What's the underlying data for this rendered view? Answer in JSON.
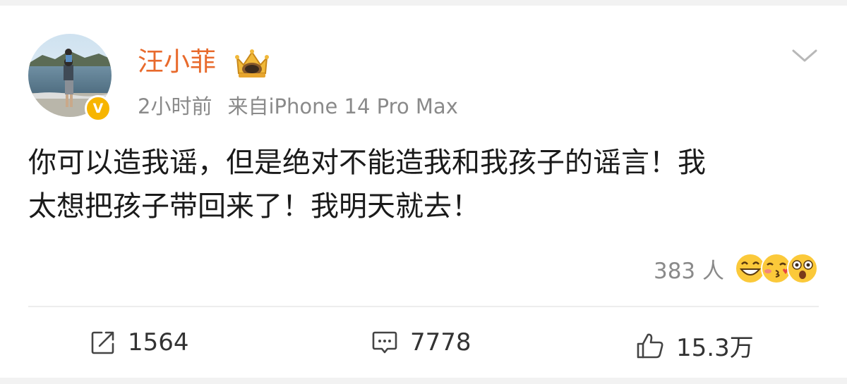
{
  "post": {
    "author": {
      "name": "汪小菲",
      "badge_icon": "crown-badge-icon",
      "verified_icon": "verified-v-icon",
      "verified_mark": "V",
      "name_color": "#e86a2c"
    },
    "time": "2小时前",
    "source": "来自iPhone 14 Pro Max",
    "text": "你可以造我谣，但是绝对不能造我和我孩子的谣言！我\n太想把孩子带回来了！我明天就去！",
    "reactions": {
      "count_label": "383 人",
      "emojis": [
        "grinning-face-icon",
        "kissing-face-icon",
        "surprised-face-icon"
      ]
    },
    "actions": {
      "repost": {
        "icon": "share-icon",
        "count": "1564"
      },
      "comment": {
        "icon": "comment-icon",
        "count": "7778"
      },
      "like": {
        "icon": "thumbs-up-icon",
        "count": "15.3万"
      }
    },
    "menu_icon": "chevron-down-icon",
    "accent_color": "#f7b500"
  }
}
